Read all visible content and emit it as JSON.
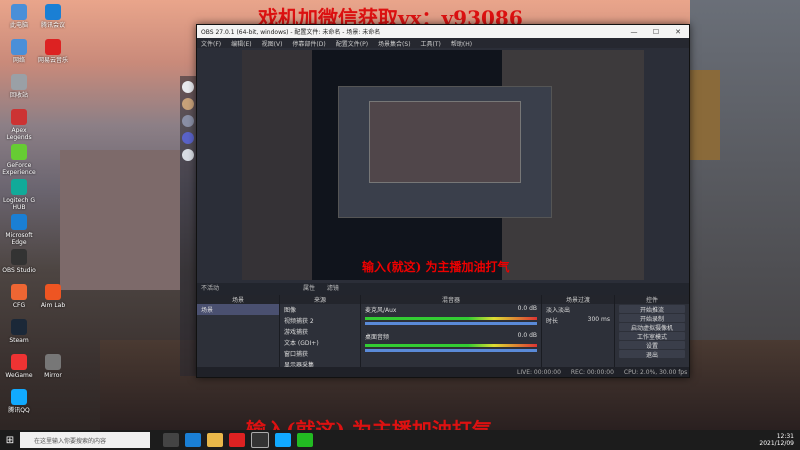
{
  "overlays": {
    "top_text": "戏机加微信获取vx：v93086",
    "bottom_text": "输入(就这) 为主播加油打气",
    "preview_text": "输入(就这) 为主播加油打气"
  },
  "desktop_icons": [
    {
      "label": "此电脑",
      "color": "#4a8fd8"
    },
    {
      "label": "网络",
      "color": "#4a8fd8"
    },
    {
      "label": "回收站",
      "color": "#9aa0a6"
    },
    {
      "label": "Apex Legends",
      "color": "#c33"
    },
    {
      "label": "GeForce Experience",
      "color": "#6c3"
    },
    {
      "label": "Logitech G HUB",
      "color": "#1a9"
    },
    {
      "label": "Microsoft Edge",
      "color": "#1a7fd4"
    },
    {
      "label": "OBS Studio",
      "color": "#333"
    },
    {
      "label": "CFG",
      "color": "#e63"
    },
    {
      "label": "Steam",
      "color": "#1b2838"
    },
    {
      "label": "WeGame",
      "color": "#e33"
    },
    {
      "label": "腾讯QQ",
      "color": "#1af"
    },
    {
      "label": "腾讯会议",
      "color": "#1a7fd4"
    },
    {
      "label": "网易云音乐",
      "color": "#d22"
    },
    {
      "label": "Aim Lab",
      "color": "#e52"
    },
    {
      "label": "Mirror",
      "color": "#777"
    }
  ],
  "obs": {
    "title": "OBS 27.0.1 (64-bit, windows) - 配置文件: 未命名 - 场景: 未命名",
    "menu": [
      "文件(F)",
      "编辑(E)",
      "视图(V)",
      "停靠部件(D)",
      "配置文件(P)",
      "场景集合(S)",
      "工具(T)",
      "帮助(H)"
    ],
    "window_buttons": [
      "—",
      "☐",
      "✕"
    ],
    "scene_bar": [
      "不活动",
      "属性",
      "滤镜"
    ],
    "docks": {
      "scenes": {
        "title": "场景",
        "items": [
          "场景"
        ]
      },
      "sources": {
        "title": "来源",
        "items": [
          "图像",
          "视频捕获 2",
          "游戏捕获",
          "文本 (GDI+)",
          "窗口捕获",
          "显示器采集"
        ]
      },
      "mixer": {
        "title": "混音器",
        "channels": [
          {
            "name": "麦克风/Aux",
            "level": "0.0 dB"
          },
          {
            "name": "桌面音频",
            "level": "0.0 dB"
          }
        ]
      },
      "transitions": {
        "title": "场景过渡",
        "type": "淡入淡出",
        "duration_label": "时长",
        "duration": "300 ms"
      },
      "controls": {
        "title": "控件",
        "buttons": [
          "开始推流",
          "开始录制",
          "启动虚拟摄像机",
          "工作室模式",
          "设置",
          "退出"
        ]
      }
    },
    "status": {
      "live": "LIVE: 00:00:00",
      "rec": "REC: 00:00:00",
      "cpu": "CPU: 2.0%, 30.00 fps"
    }
  },
  "taskbar": {
    "search_placeholder": "在这里输入你要搜索的内容",
    "time": "12:31",
    "date": "2021/12/09"
  }
}
